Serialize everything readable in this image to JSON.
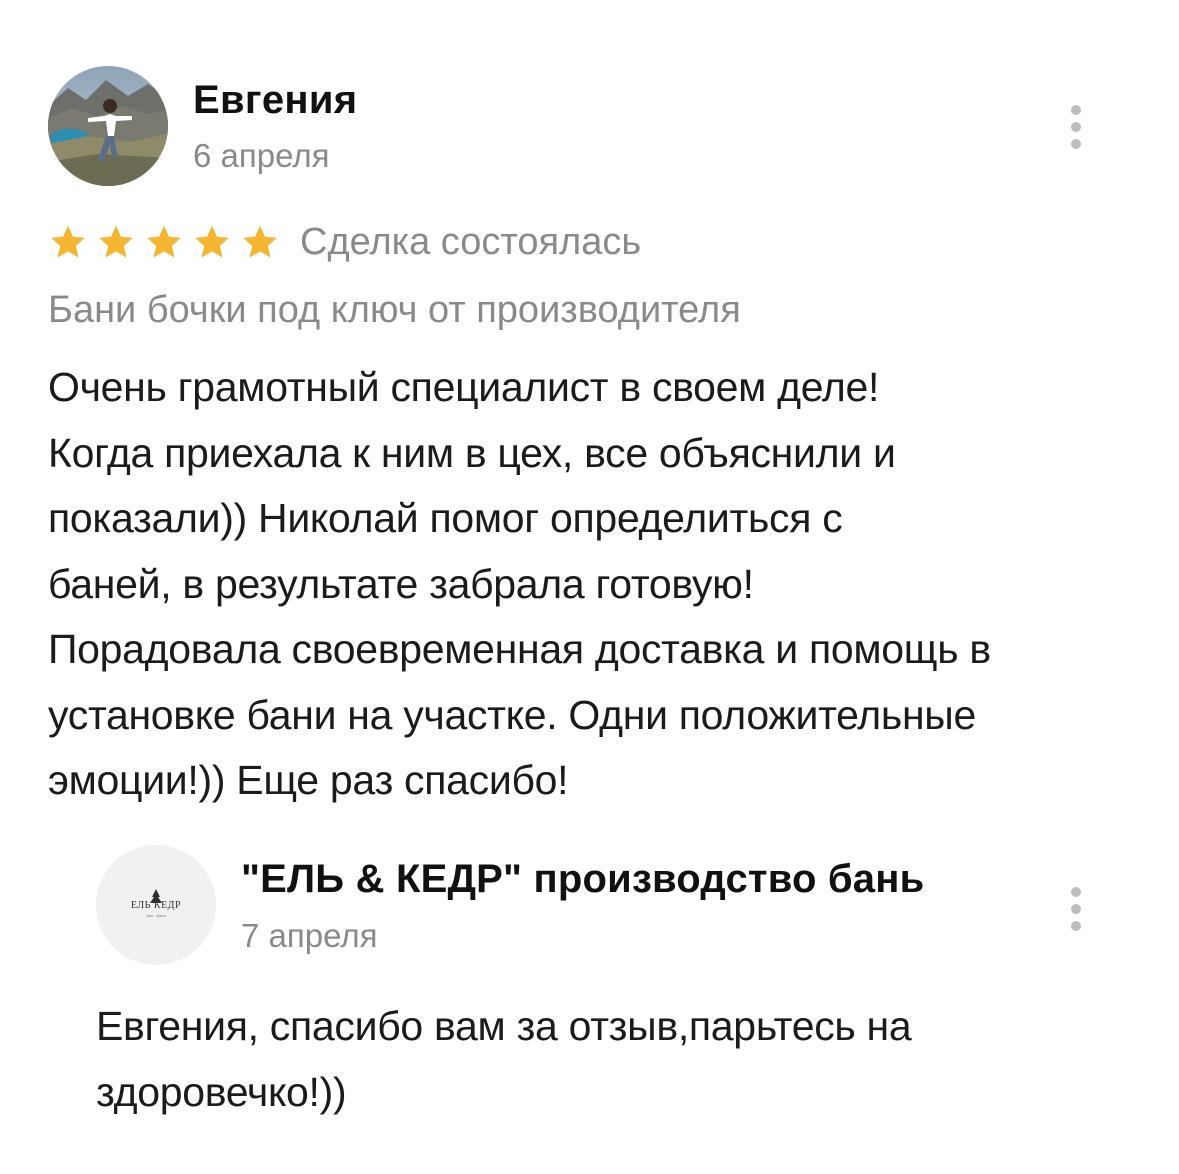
{
  "review": {
    "author": "Евгения",
    "date": "6 апреля",
    "rating": 5,
    "rating_max": 5,
    "deal_status": "Сделка состоялась",
    "service": "Бани бочки под ключ от производителя",
    "text_lines": [
      "Очень грамотный специалист в своем деле!",
      "Когда приехала к ним в цех, все объяснили и",
      "показали)) Николай помог определиться с",
      "баней, в результате забрала готовую!",
      "Порадовала своевременная доставка и помощь в",
      "установке бани на участке. Одни положительные",
      "эмоции!)) Еще раз спасибо!"
    ],
    "more_icon": "kebab-menu-icon"
  },
  "reply": {
    "author": "\"ЕЛЬ & КЕДР\" производство бань",
    "date": "7 апреля",
    "logo_text": "ЕЛЬ КЕДР",
    "logo_subtext": "Эко · Бани",
    "text_lines": [
      "Евгения, спасибо вам за отзыв,парьтесь на",
      "здоровечко!))"
    ],
    "more_icon": "kebab-menu-icon"
  },
  "colors": {
    "star": "#F5B731",
    "muted_text": "#8A8A8A",
    "body_text": "#1B1B1B",
    "kebab_dots": "#BDBDBD"
  }
}
